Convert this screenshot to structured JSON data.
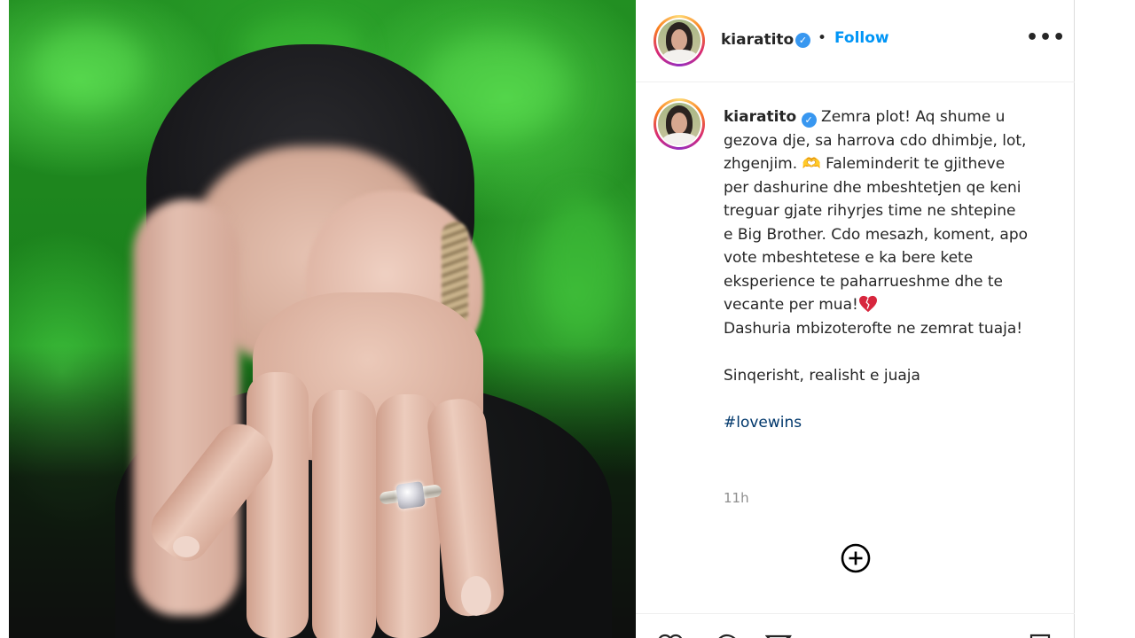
{
  "post": {
    "username": "kiaratito",
    "follow_label": "Follow",
    "separator": "•",
    "more_icon": "more-options-icon",
    "verified_icon": "verified-badge-icon"
  },
  "caption": {
    "username": "kiaratito",
    "text_1": "Zemra plot! Aq shume u gezova dje, sa harrova cdo dhimbje, lot, zhgenjim. 🫶 Faleminderit te gjitheve per dashurine dhe mbeshtetjen qe keni treguar gjate rihyrjes time ne shtepine e Big Brother. Cdo mesazh, koment, apo vote mbeshtetese e ka bere kete eksperience te paharrueshme dhe te vecante per mua!",
    "text_2": "Dashuria mbizoterofte ne zemrat tuaja!",
    "text_3": "Sinqerisht, realisht e juaja",
    "hashtag": "#lovewins",
    "emoji_icon": "broken-heart-icon",
    "time": "11h"
  },
  "controls": {
    "load_more_icon": "plus-circle-icon",
    "actions": [
      "like-icon",
      "comment-icon",
      "share-icon",
      "save-icon"
    ]
  },
  "colors": {
    "link_blue": "#0095f6",
    "verified_blue": "#3897f0",
    "text": "#262626",
    "muted": "#8e8e8e"
  }
}
